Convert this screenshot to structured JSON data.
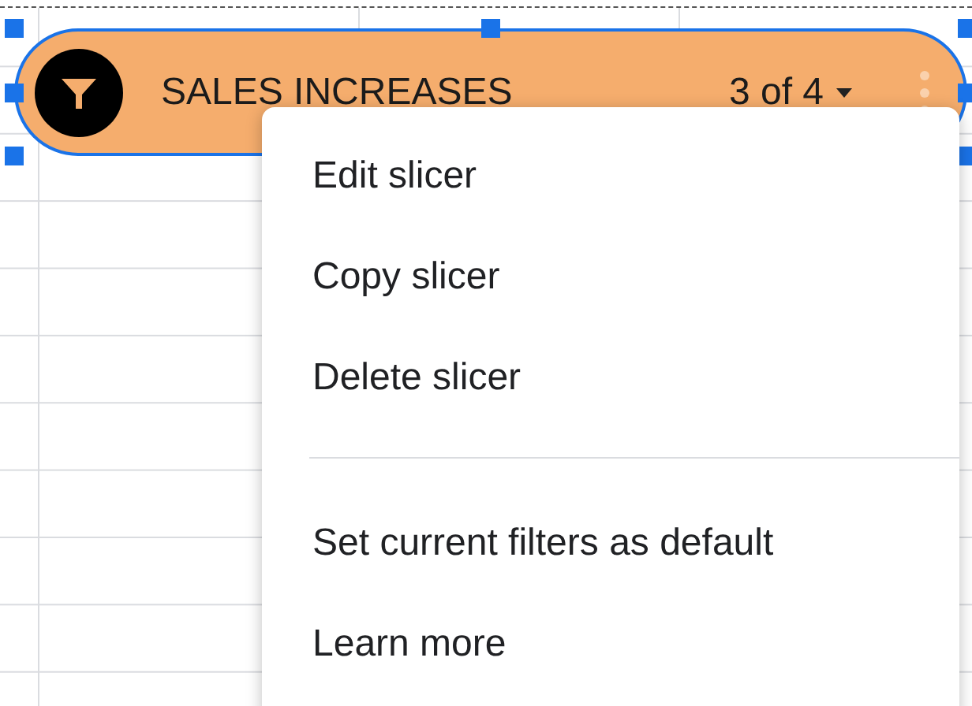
{
  "slicer": {
    "title": "SALES INCREASES",
    "status": "3 of 4",
    "selected": true
  },
  "menu": [
    {
      "kind": "item",
      "label": "Edit slicer"
    },
    {
      "kind": "item",
      "label": "Copy slicer"
    },
    {
      "kind": "item",
      "label": "Delete slicer"
    },
    {
      "kind": "divider"
    },
    {
      "kind": "item",
      "label": "Set current filters as default"
    },
    {
      "kind": "item",
      "label": "Learn more"
    }
  ]
}
